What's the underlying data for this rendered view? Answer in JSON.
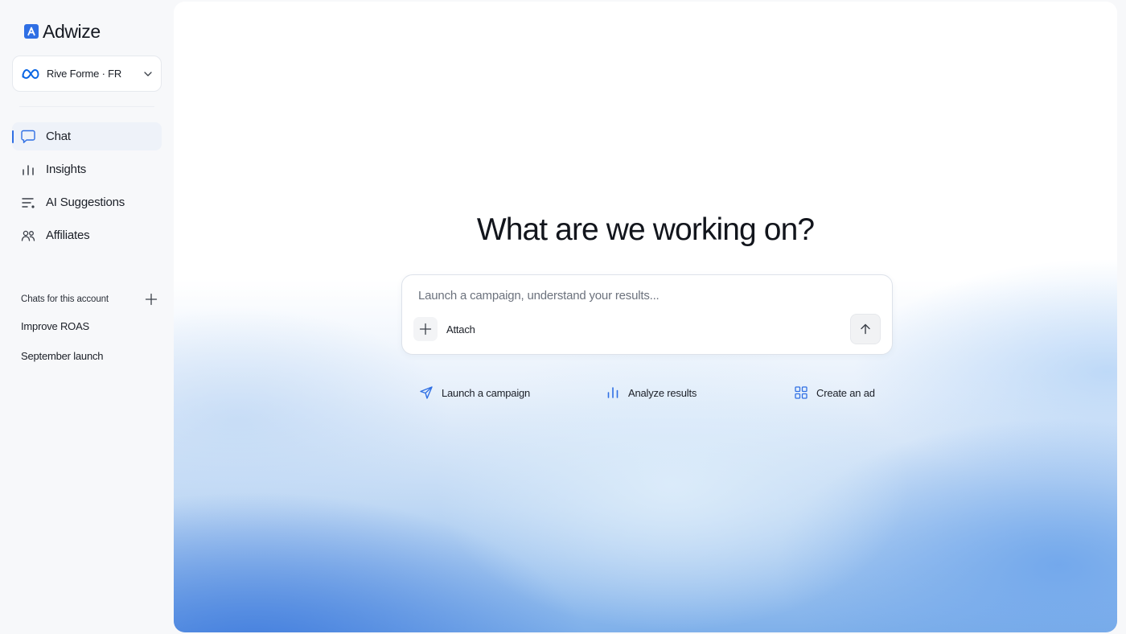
{
  "app": {
    "name": "Adwize"
  },
  "account": {
    "name": "Rive Forme · FR",
    "icon": "meta-icon"
  },
  "nav": [
    {
      "label": "Chat",
      "icon": "chat-bubble-icon",
      "active": true
    },
    {
      "label": "Insights",
      "icon": "bar-chart-icon",
      "active": false
    },
    {
      "label": "AI Suggestions",
      "icon": "list-sparkle-icon",
      "active": false
    },
    {
      "label": "Affiliates",
      "icon": "people-icon",
      "active": false
    }
  ],
  "chats": {
    "title": "Chats for this account",
    "items": [
      "Improve ROAS",
      "September launch"
    ]
  },
  "main": {
    "headline": "What are we working on?",
    "composer": {
      "placeholder": "Launch a campaign, understand your results...",
      "value": "",
      "attach_label": "Attach"
    },
    "suggestions": [
      {
        "label": "Launch a campaign",
        "icon": "paper-plane-icon"
      },
      {
        "label": "Analyze results",
        "icon": "bar-chart-icon"
      },
      {
        "label": "Create an ad",
        "icon": "grid-icon"
      }
    ]
  },
  "colors": {
    "accent": "#2f6fe4",
    "meta_blue": "#0a66e4"
  }
}
